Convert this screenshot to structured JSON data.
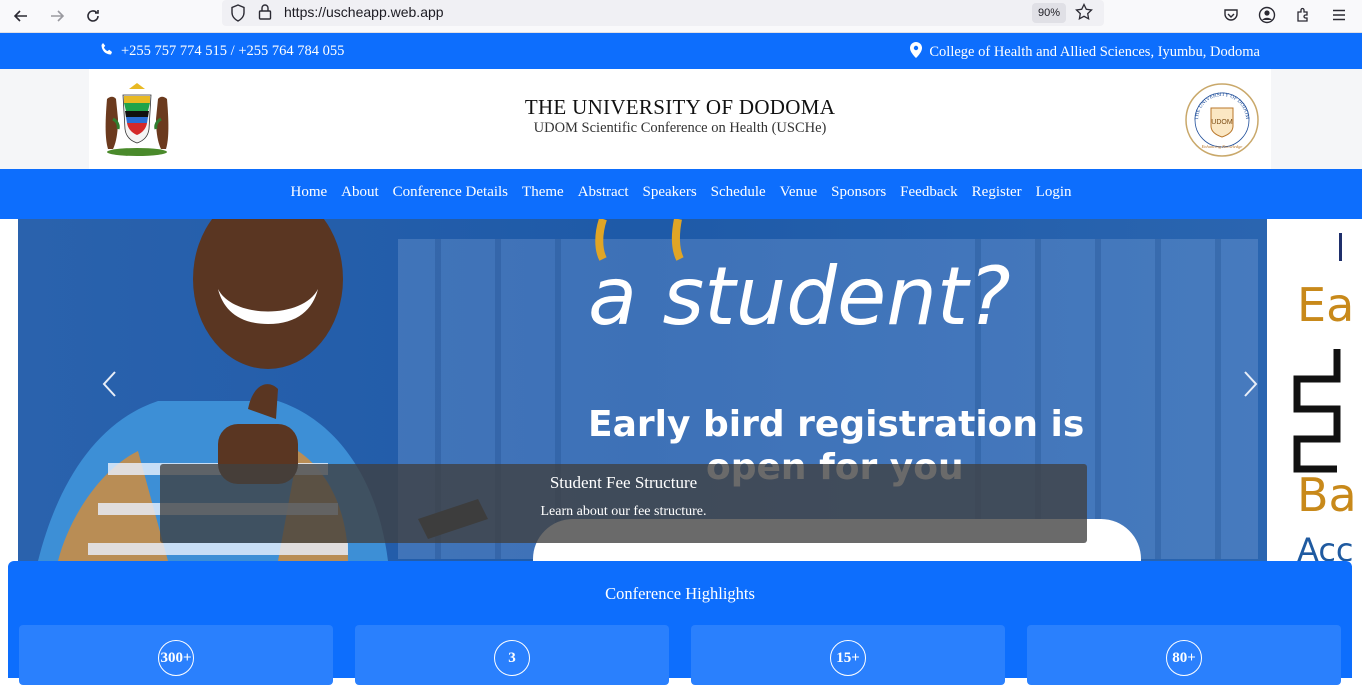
{
  "browser": {
    "url": "https://uscheapp.web.app",
    "zoom": "90%"
  },
  "infobar": {
    "phone": "+255 757 774 515 / +255 764 784 055",
    "address": "College of Health and Allied Sciences, Iyumbu, Dodoma"
  },
  "header": {
    "title": "THE UNIVERSITY OF DODOMA",
    "subtitle": "UDOM Scientific Conference on Health (USCHe)",
    "seal_text": "UDOM"
  },
  "nav": {
    "items": [
      "Home",
      "About",
      "Conference Details",
      "Theme",
      "Abstract",
      "Speakers",
      "Schedule",
      "Venue",
      "Sponsors",
      "Feedback",
      "Register",
      "Login"
    ]
  },
  "carousel": {
    "slide_heading": "a student?",
    "slide_line1": "Early bird registration is",
    "slide_line2": "open for you",
    "caption_title": "Student Fee Structure",
    "caption_text": "Learn about our fee structure.",
    "peek_lines": [
      "Ea",
      "Ba",
      "Acc"
    ]
  },
  "highlights": {
    "title": "Conference Highlights",
    "stats": [
      "300+",
      "3",
      "15+",
      "80+"
    ]
  },
  "colors": {
    "primary": "#0d6efd",
    "card": "#2a80fd"
  }
}
